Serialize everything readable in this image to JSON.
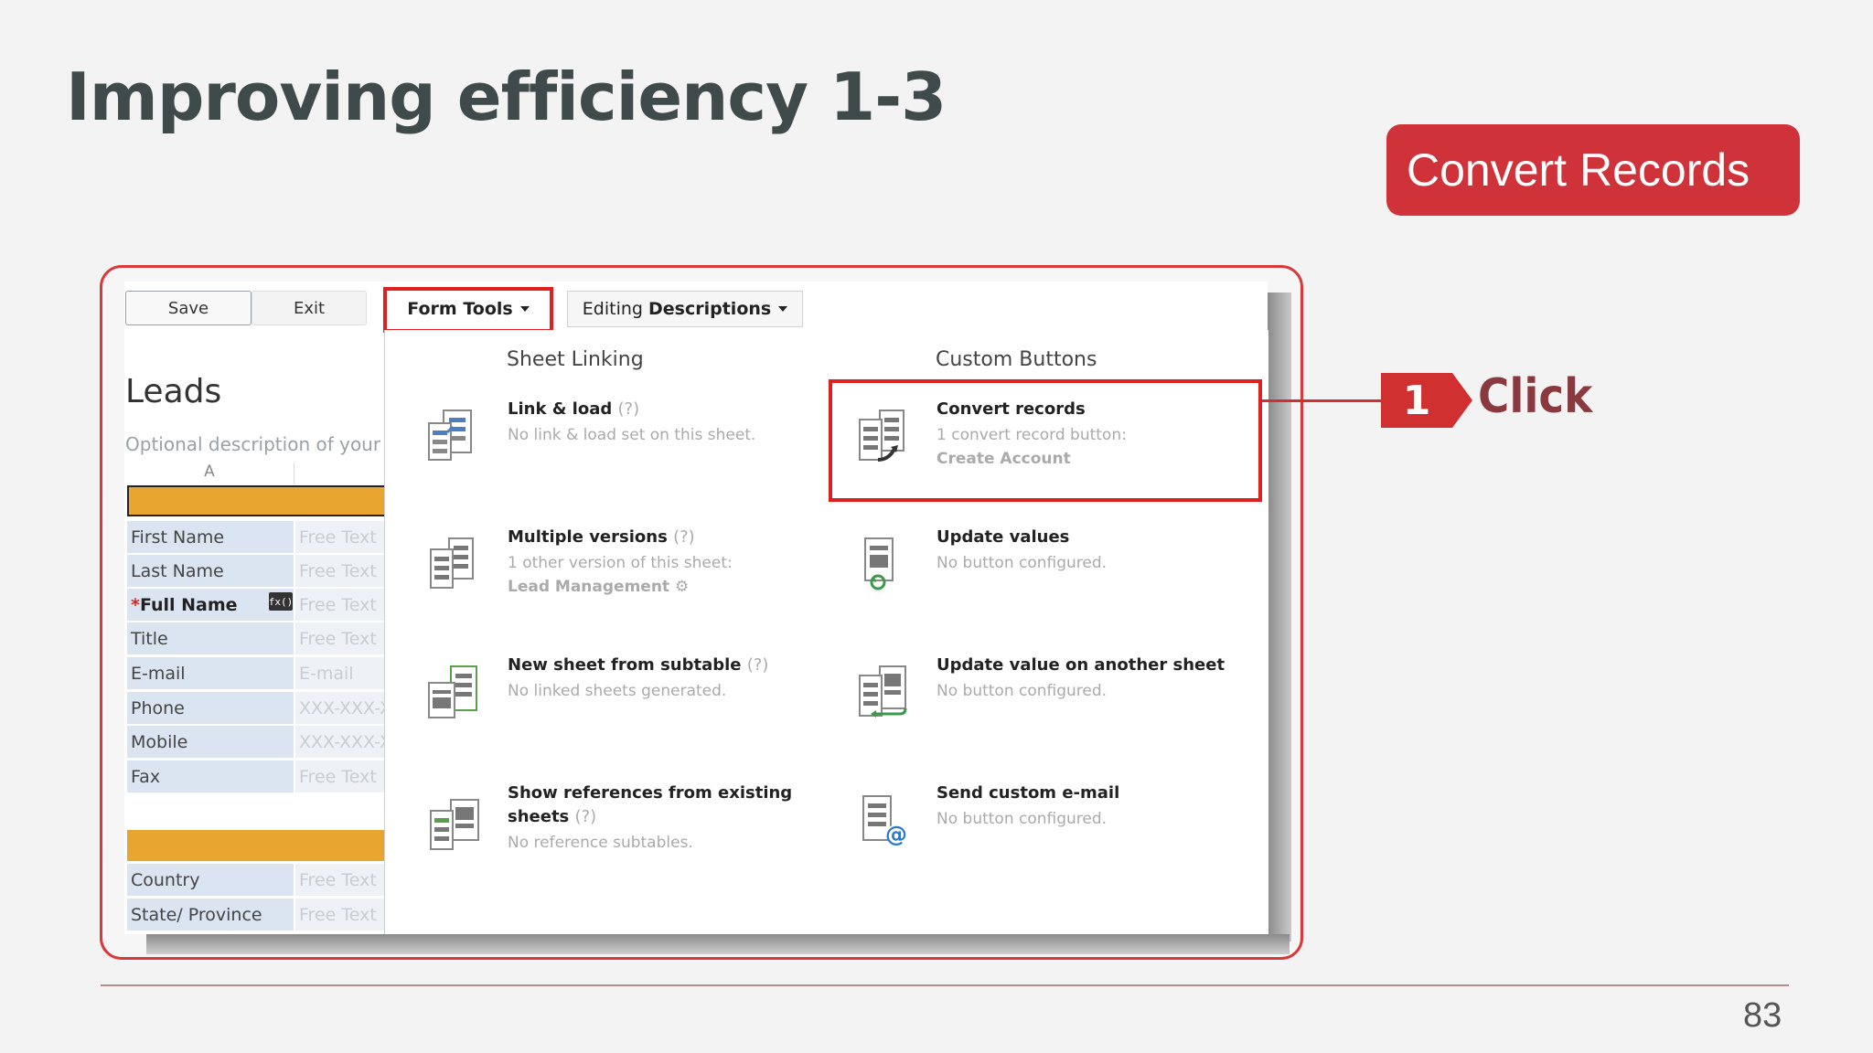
{
  "slide": {
    "title": "Improving efficiency 1-3",
    "badge": "Convert Records",
    "page_number": "83"
  },
  "toolbar": {
    "save_label": "Save",
    "exit_label": "Exit",
    "form_tools_label": "Form Tools",
    "editing_prefix": "Editing",
    "editing_bold": "Descriptions"
  },
  "form": {
    "title": "Leads",
    "description": "Optional description of your fo",
    "column_header": "A",
    "fields": [
      {
        "label": "First Name",
        "value": "Free Text"
      },
      {
        "label": "Last Name",
        "value": "Free Text"
      },
      {
        "label": "Full Name",
        "value": "Free Text",
        "required_mark": "*"
      },
      {
        "label": "Title",
        "value": "Free Text"
      },
      {
        "label": "E-mail",
        "value": "E-mail"
      },
      {
        "label": "Phone",
        "value": "XXX-XXX-X"
      },
      {
        "label": "Mobile",
        "value": "XXX-XXX-X"
      },
      {
        "label": "Fax",
        "value": "Free Text"
      },
      {
        "label": "Country",
        "value": "Free Text"
      },
      {
        "label": "State/ Province",
        "value": "Free Text"
      }
    ],
    "fx_label": "fx()"
  },
  "menu": {
    "sheet_linking": {
      "heading": "Sheet Linking",
      "items": [
        {
          "title": "Link & load",
          "help": "(?)",
          "sub": "No link & load set on this sheet.",
          "icon": "link-load-icon"
        },
        {
          "title": "Multiple versions",
          "help": "(?)",
          "sub": "1 other version of this sheet:",
          "sub2": "Lead Management",
          "icon": "multiple-versions-icon"
        },
        {
          "title": "New sheet from subtable",
          "help": "(?)",
          "sub": "No linked sheets generated.",
          "icon": "new-sheet-icon"
        },
        {
          "title": "Show references from existing",
          "title2": "sheets",
          "help": "(?)",
          "sub": "No reference subtables.",
          "icon": "references-icon"
        }
      ]
    },
    "custom_buttons": {
      "heading": "Custom Buttons",
      "items": [
        {
          "title": "Convert records",
          "sub": "1 convert record button:",
          "sub2": "Create Account",
          "icon": "convert-records-icon"
        },
        {
          "title": "Update values",
          "sub": "No button configured.",
          "icon": "update-values-icon"
        },
        {
          "title": "Update value on another sheet",
          "sub": "No button configured.",
          "icon": "update-other-sheet-icon"
        },
        {
          "title": "Send custom e-mail",
          "sub": "No button configured.",
          "icon": "send-email-icon"
        }
      ]
    }
  },
  "callout": {
    "step": "1",
    "label": "Click"
  },
  "colors": {
    "accent_red": "#d0323a",
    "highlight_red": "#e02020",
    "section_orange": "#e8a530",
    "field_label_bg": "#dbe5f1"
  }
}
